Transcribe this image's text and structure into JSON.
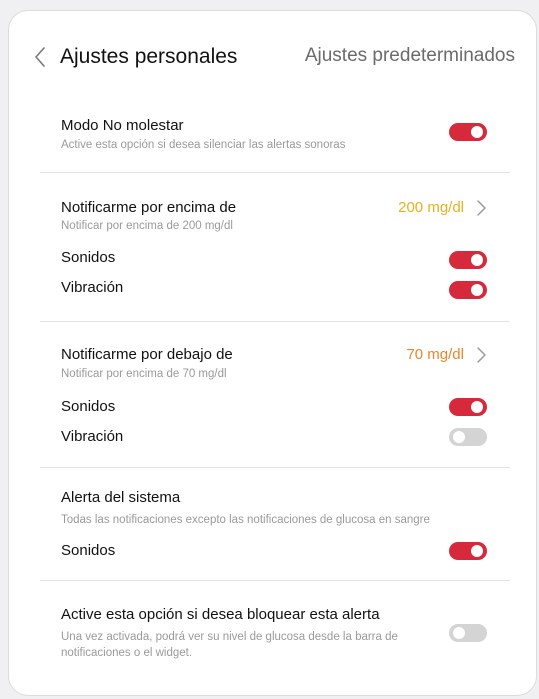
{
  "header": {
    "title": "Ajustes personales",
    "preset_label": "Ajustes predeterminados"
  },
  "dnd": {
    "label": "Modo No molestar",
    "desc": "Active esta opción si desea silenciar las alertas sonoras",
    "on": true
  },
  "above": {
    "label": "Notificarme por encima de",
    "desc": "Notificar por encima de 200 mg/dl",
    "value": "200 mg/dl",
    "value_color": "#e3b21c",
    "sounds_label": "Sonidos",
    "sounds_on": true,
    "vibration_label": "Vibración",
    "vibration_on": true
  },
  "below": {
    "label": "Notificarme por debajo de",
    "desc": "Notificar por encima de 70 mg/dl",
    "value": "70 mg/dl",
    "value_color": "#e8862b",
    "sounds_label": "Sonidos",
    "sounds_on": true,
    "vibration_label": "Vibración",
    "vibration_on": false
  },
  "system": {
    "label": "Alerta del sistema",
    "desc": "Todas las notificaciones excepto las notificaciones de glucosa en sangre",
    "sounds_label": "Sonidos",
    "sounds_on": true
  },
  "block": {
    "label": "Active esta opción si desea bloquear esta alerta",
    "desc": "Una vez activada, podrá ver su nivel de glucosa desde la barra de notificaciones o el widget.",
    "on": false
  },
  "colors": {
    "toggle_on": "#d6293b",
    "toggle_off": "#d4d4d4"
  },
  "icons": {
    "back": "chevron-left-icon",
    "value_chevron": "chevron-right-icon"
  }
}
